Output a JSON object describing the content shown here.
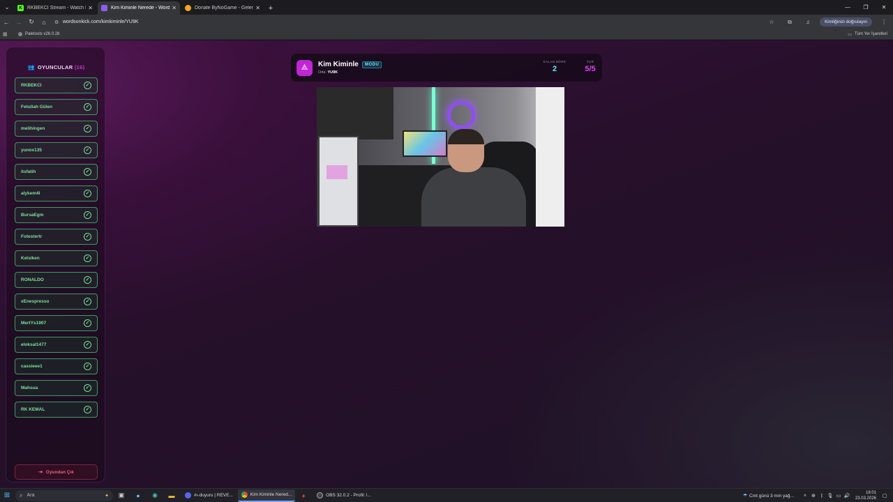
{
  "browser": {
    "tabs": [
      {
        "title": "RKBEKCI Stream - Watch Live o",
        "active": false,
        "favicon": "K"
      },
      {
        "title": "Kim Kiminle Nerede - Words O",
        "active": true,
        "favicon": ""
      },
      {
        "title": "Donate ByNoGame - Gelen/Gid",
        "active": false,
        "favicon": ""
      }
    ],
    "url": "wordsonkick.com/kimkiminle/YU9K",
    "profile_label": "Kimliğinizi doğrulayın",
    "bookmarks": [
      {
        "label": "Paletools v26.0.28"
      }
    ],
    "all_bookmarks_label": "Tüm Yer İşaretleri"
  },
  "players_panel": {
    "title": "OYUNCULAR",
    "count_open": "(",
    "count": "16",
    "count_close": ")",
    "players": [
      {
        "name": "RKBEKCI"
      },
      {
        "name": "Fetullah Gülen"
      },
      {
        "name": "melihingen"
      },
      {
        "name": "yunox135"
      },
      {
        "name": "itsfatih"
      },
      {
        "name": "alykem4l"
      },
      {
        "name": "BursaEgm"
      },
      {
        "name": "Fotestertr"
      },
      {
        "name": "Kelsiken"
      },
      {
        "name": "RONALDO"
      },
      {
        "name": "xEnespresso"
      },
      {
        "name": "MertYs1907"
      },
      {
        "name": "eloksal1477"
      },
      {
        "name": "cassieee1"
      },
      {
        "name": "Mahsua"
      },
      {
        "name": "RK KEMAL"
      }
    ],
    "leave_button_label": "Oyundan Çık"
  },
  "game": {
    "title": "Kim Kiminle",
    "mode_badge": "MODU",
    "room_label": "Oda:",
    "room_code": "YU9K",
    "remaining_label": "KALAN BÖRE",
    "remaining_value": "2",
    "round_label": "TUR",
    "round_value": "5/5"
  },
  "taskbar": {
    "search_placeholder": "Ara",
    "apps": [
      {
        "label": "#ı-duyuru | REVE...",
        "active": false,
        "color": "#5865f2"
      },
      {
        "label": "Kim Kiminle Nered...",
        "active": true,
        "color": "#4caf50"
      },
      {
        "label": "OBS 32.0.2 - Profil: l...",
        "active": false,
        "color": "#444444"
      }
    ],
    "weather": "Cmt günü 3 mm yağ...",
    "time": "18:01",
    "date": "23.03.2026"
  },
  "colors": {
    "accent_magenta": "#c026d3",
    "player_green": "#7de09a",
    "mode_cyan": "#67e8f9",
    "leave_red": "#e8607a"
  }
}
